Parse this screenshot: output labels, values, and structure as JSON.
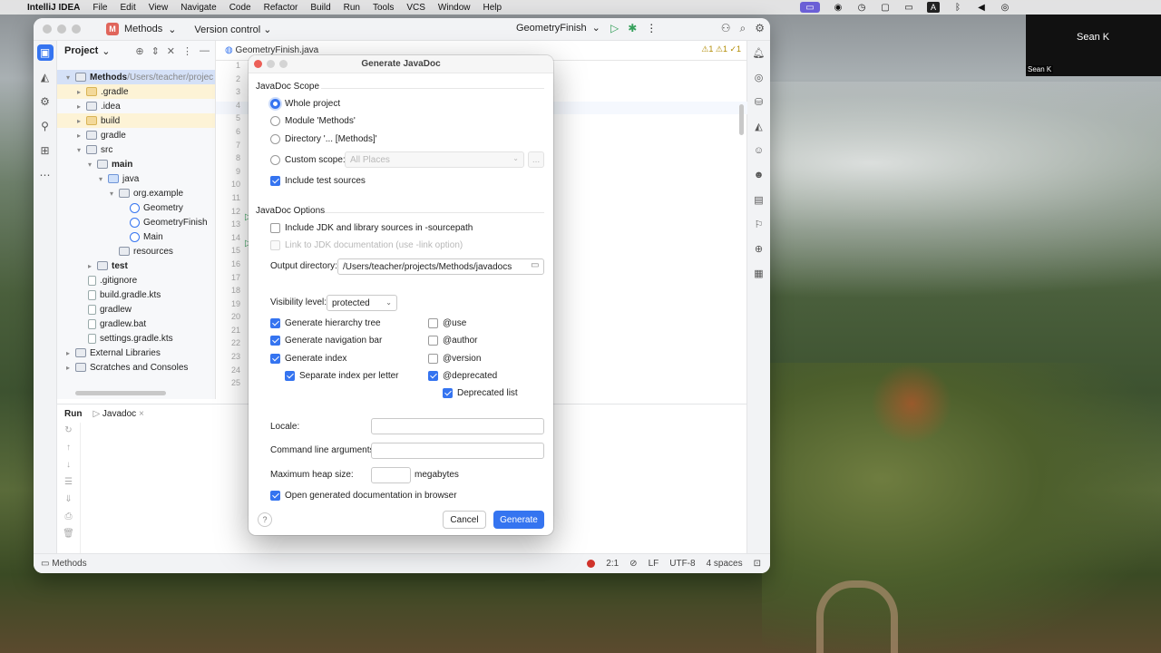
{
  "macos": {
    "app_name": "IntelliJ IDEA",
    "menu": [
      "File",
      "Edit",
      "View",
      "Navigate",
      "Code",
      "Refactor",
      "Build",
      "Run",
      "Tools",
      "VCS",
      "Window",
      "Help"
    ]
  },
  "video": {
    "name": "Sean K",
    "label": "Sean K"
  },
  "ide": {
    "project_badge": "M",
    "project_name": "Methods",
    "vcs_label": "Version control",
    "run_config": "GeometryFinish",
    "editor_tab": "GeometryFinish.java",
    "inspections": "⚠1  ⚠1  ✓1",
    "project_panel_title": "Project",
    "tree": [
      {
        "label": "Methods",
        "extra": " /Users/teacher/projec",
        "bold": true
      },
      {
        "label": ".gradle"
      },
      {
        "label": ".idea"
      },
      {
        "label": "build"
      },
      {
        "label": "gradle"
      },
      {
        "label": "src"
      },
      {
        "label": "main",
        "bold": true
      },
      {
        "label": "java"
      },
      {
        "label": "org.example"
      },
      {
        "label": "Geometry"
      },
      {
        "label": "GeometryFinish"
      },
      {
        "label": "Main"
      },
      {
        "label": "resources"
      },
      {
        "label": "test",
        "bold": true
      },
      {
        "label": ".gitignore"
      },
      {
        "label": "build.gradle.kts"
      },
      {
        "label": "gradlew"
      },
      {
        "label": "gradlew.bat"
      },
      {
        "label": "settings.gradle.kts"
      },
      {
        "label": "External Libraries"
      },
      {
        "label": "Scratches and Consoles"
      }
    ],
    "line_numbers": [
      "1",
      "2",
      "3",
      "4",
      "5",
      "6",
      "7",
      "8",
      "9",
      "10",
      "11",
      "12",
      "13",
      "14",
      "15",
      "16",
      "17",
      "18",
      "19",
      "20",
      "21",
      "22",
      "23",
      "24",
      "25"
    ],
    "bottom_tabs": {
      "run": "Run",
      "javadoc": "Javadoc"
    },
    "status": {
      "breadcrumb": "Methods",
      "position": "2:1",
      "line_sep": "LF",
      "encoding": "UTF-8",
      "indent": "4 spaces"
    }
  },
  "dialog": {
    "title": "Generate JavaDoc",
    "scope_title": "JavaDoc Scope",
    "scope_options": {
      "whole_project": "Whole project",
      "module": "Module 'Methods'",
      "directory": "Directory '... [Methods]'",
      "custom": "Custom scope:"
    },
    "custom_scope_value": "All Places",
    "custom_scope_more": "...",
    "include_test_sources": "Include test sources",
    "options_title": "JavaDoc Options",
    "include_jdk": "Include JDK and library sources in -sourcepath",
    "link_jdk": "Link to JDK documentation (use -link option)",
    "output_dir_label": "Output directory:",
    "output_dir_value": "/Users/teacher/projects/Methods/javadocs",
    "visibility_label": "Visibility level:",
    "visibility_value": "protected",
    "gen_hierarchy": "Generate hierarchy tree",
    "gen_nav": "Generate navigation bar",
    "gen_index": "Generate index",
    "sep_index": "Separate index per letter",
    "use": "@use",
    "author": "@author",
    "version": "@version",
    "deprecated": "@deprecated",
    "deprecated_list": "Deprecated list",
    "locale_label": "Locale:",
    "cmd_args_label": "Command line arguments:",
    "heap_label": "Maximum heap size:",
    "heap_unit": "megabytes",
    "open_browser": "Open generated documentation in browser",
    "help": "?",
    "cancel": "Cancel",
    "generate": "Generate"
  },
  "colors": {
    "accent": "#3574f0",
    "warning": "#b08a00",
    "run_green": "#36a05b"
  }
}
